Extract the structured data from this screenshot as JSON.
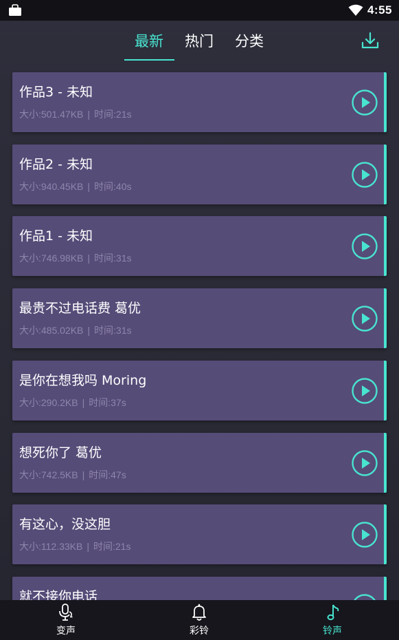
{
  "status_bar": {
    "time": "4:55"
  },
  "tabs": [
    {
      "label": "最新",
      "active": true
    },
    {
      "label": "热门",
      "active": false
    },
    {
      "label": "分类",
      "active": false
    }
  ],
  "colors": {
    "accent": "#48e4cf",
    "card": "#564c78",
    "background": "#2b2b38"
  },
  "icons": {
    "status_left": "bag-icon",
    "status_wifi": "wifi-icon",
    "download": "download-icon",
    "play": "play-icon"
  },
  "meta_labels": {
    "size_prefix": "大小:",
    "time_prefix": "时间:",
    "separator": "|"
  },
  "tracks": [
    {
      "title": "作品3 - 未知",
      "size": "大小:501.47KB",
      "duration": "时间:21s"
    },
    {
      "title": "作品2 - 未知",
      "size": "大小:940.45KB",
      "duration": "时间:40s"
    },
    {
      "title": "作品1 - 未知",
      "size": "大小:746.98KB",
      "duration": "时间:31s"
    },
    {
      "title": "最贵不过电话费 葛优",
      "size": "大小:485.02KB",
      "duration": "时间:31s"
    },
    {
      "title": "是你在想我吗 Moring",
      "size": "大小:290.2KB",
      "duration": "时间:37s"
    },
    {
      "title": "想死你了 葛优",
      "size": "大小:742.5KB",
      "duration": "时间:47s"
    },
    {
      "title": "有这心，没这胆",
      "size": "大小:112.33KB",
      "duration": "时间:21s"
    },
    {
      "title": "就不接你电话",
      "size": "",
      "duration": ""
    }
  ],
  "bottom_nav": [
    {
      "label": "变声",
      "icon": "voice-change-icon",
      "active": false
    },
    {
      "label": "彩铃",
      "icon": "bell-icon",
      "active": false
    },
    {
      "label": "铃声",
      "icon": "music-note-icon",
      "active": true
    }
  ]
}
